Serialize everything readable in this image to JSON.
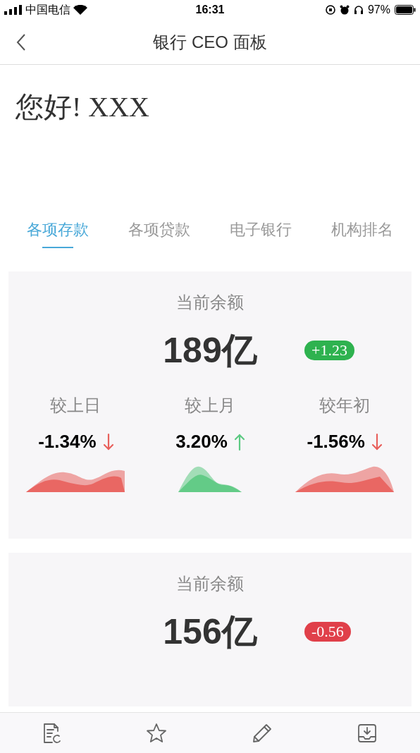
{
  "status_bar": {
    "carrier": "中国电信",
    "time": "16:31",
    "battery": "97%"
  },
  "nav": {
    "title": "银行 CEO 面板"
  },
  "greeting": "您好! XXX",
  "tabs": [
    {
      "label": "各项存款",
      "selected": true
    },
    {
      "label": "各项贷款",
      "selected": false
    },
    {
      "label": "电子银行",
      "selected": false
    },
    {
      "label": "机构排名",
      "selected": false
    }
  ],
  "cards": [
    {
      "title": "当前余额",
      "value": "189亿",
      "badge": {
        "text": "+1.23",
        "color": "#2eb24f"
      },
      "metrics": [
        {
          "label": "较上日",
          "change": "-1.34%",
          "kind": "down",
          "color": "#e8605c"
        },
        {
          "label": "较上月",
          "change": "3.20%",
          "kind": "up",
          "color": "#5cc982"
        },
        {
          "label": "较年初",
          "change": "-1.56%",
          "kind": "down",
          "color": "#e8605c"
        }
      ]
    },
    {
      "title": "当前余额",
      "value": "156亿",
      "badge": {
        "text": "-0.56",
        "color": "#e0404a"
      }
    }
  ],
  "bottom_tabs": [
    {
      "kind": "document"
    },
    {
      "kind": "star"
    },
    {
      "kind": "pencil"
    },
    {
      "kind": "inbox"
    }
  ]
}
